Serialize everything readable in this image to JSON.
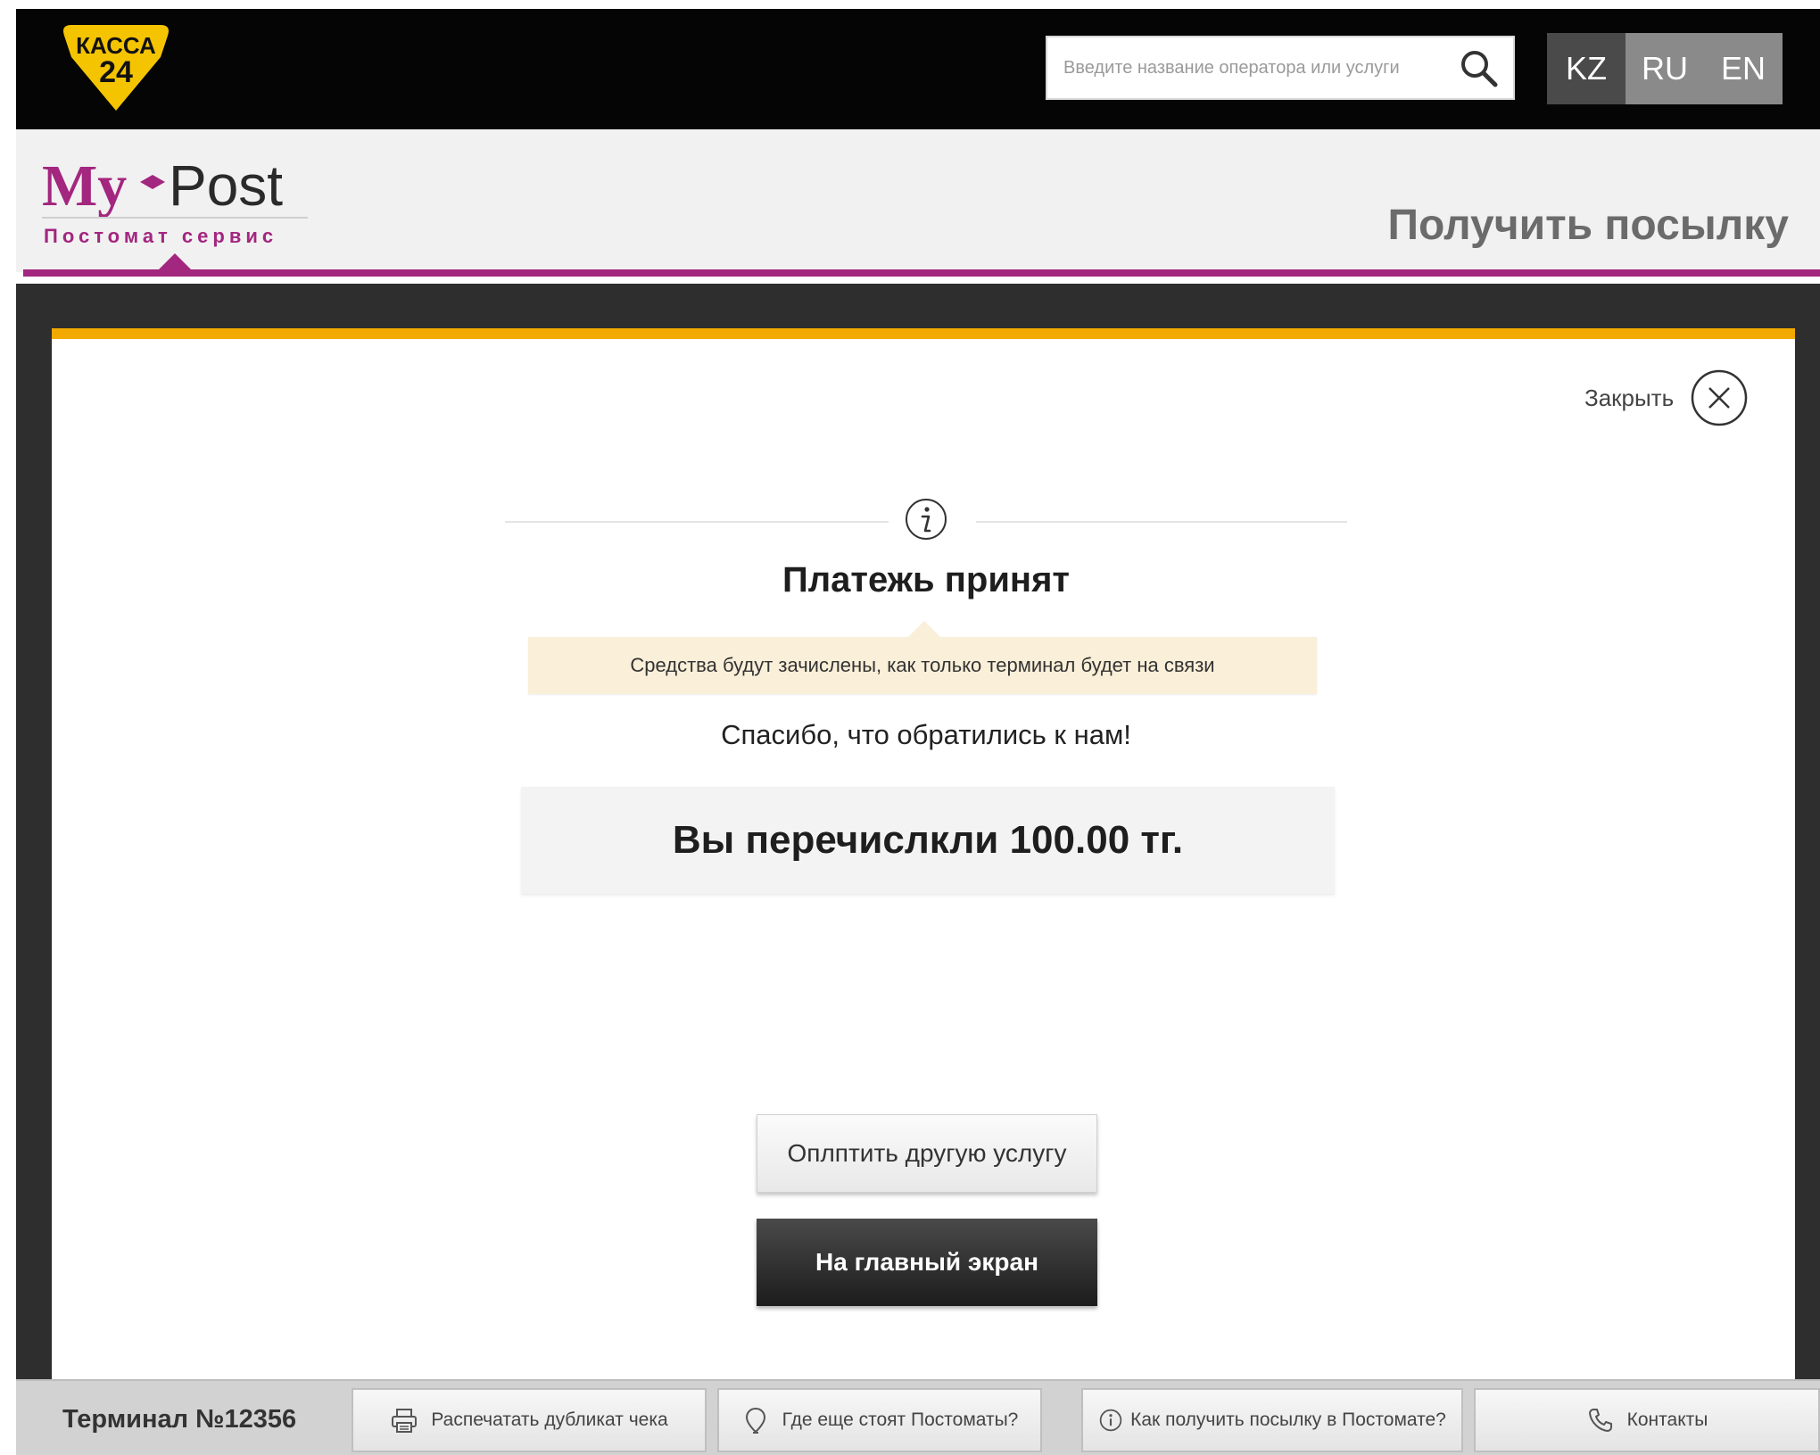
{
  "top_bar": {
    "logo": {
      "line1": "КАССА",
      "line2": "24"
    },
    "search": {
      "placeholder": "Введите название оператора или услуги"
    },
    "languages": [
      {
        "label": "KZ",
        "active": true
      },
      {
        "label": "RU",
        "active": false
      },
      {
        "label": "EN",
        "active": false
      }
    ]
  },
  "header": {
    "brand_my": "My",
    "brand_post": "Post",
    "brand_subtitle": "Постомат сервис",
    "page_title": "Получить посылку"
  },
  "dialog": {
    "close_label": "Закрыть",
    "heading": "Платежь принят",
    "notice": "Средства будут зачислены, как только терминал будет на связи",
    "thanks": "Спасибо, что обратились к нам!",
    "amount_text": "Вы перечислкли 100.00 тг.",
    "pay_other_label": "Оплптить другую услугу",
    "home_label": "На главный экран"
  },
  "footer": {
    "terminal": "Терминал №12356",
    "buttons": [
      {
        "label": "Распечатать дубликат чека",
        "icon": "printer-icon"
      },
      {
        "label": "Где еще стоят Постоматы?",
        "icon": "location-pin-icon"
      },
      {
        "label": "Как получить посылку в Постомате?",
        "icon": "info-icon"
      },
      {
        "label": "Контакты",
        "icon": "phone-icon"
      }
    ]
  },
  "colors": {
    "brand_magenta": "#a3267f",
    "accent_yellow": "#f2a900",
    "kassa_yellow": "#f5c400",
    "notice_bg": "#faefd8"
  }
}
